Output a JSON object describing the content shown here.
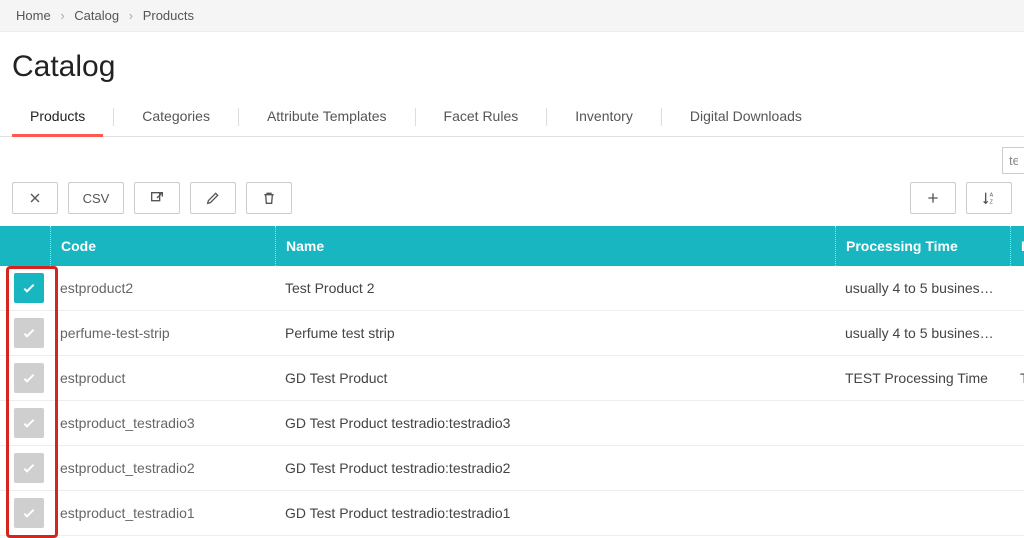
{
  "breadcrumb": [
    "Home",
    "Catalog",
    "Products"
  ],
  "page_title": "Catalog",
  "tabs": [
    "Products",
    "Categories",
    "Attribute Templates",
    "Facet Rules",
    "Inventory",
    "Digital Downloads"
  ],
  "active_tab": 0,
  "search_value": "tes",
  "toolbar": {
    "csv_label": "CSV"
  },
  "columns": {
    "code": "Code",
    "name": "Name",
    "processing": "Processing Time",
    "last": "F"
  },
  "rows": [
    {
      "checked": true,
      "code": "estproduct2",
      "name": "Test Product 2",
      "processing": "usually 4 to 5 busines…",
      "last": ""
    },
    {
      "checked": false,
      "code": "perfume-test-strip",
      "name": "Perfume test strip",
      "processing": "usually 4 to 5 busines…",
      "last": ""
    },
    {
      "checked": false,
      "code": "estproduct",
      "name": "GD Test Product",
      "processing": "TEST Processing Time",
      "last": "T"
    },
    {
      "checked": false,
      "code": "estproduct_testradio3",
      "name": "GD Test Product testradio:testradio3",
      "processing": "",
      "last": ""
    },
    {
      "checked": false,
      "code": "estproduct_testradio2",
      "name": "GD Test Product testradio:testradio2",
      "processing": "",
      "last": ""
    },
    {
      "checked": false,
      "code": "estproduct_testradio1",
      "name": "GD Test Product testradio:testradio1",
      "processing": "",
      "last": ""
    }
  ]
}
